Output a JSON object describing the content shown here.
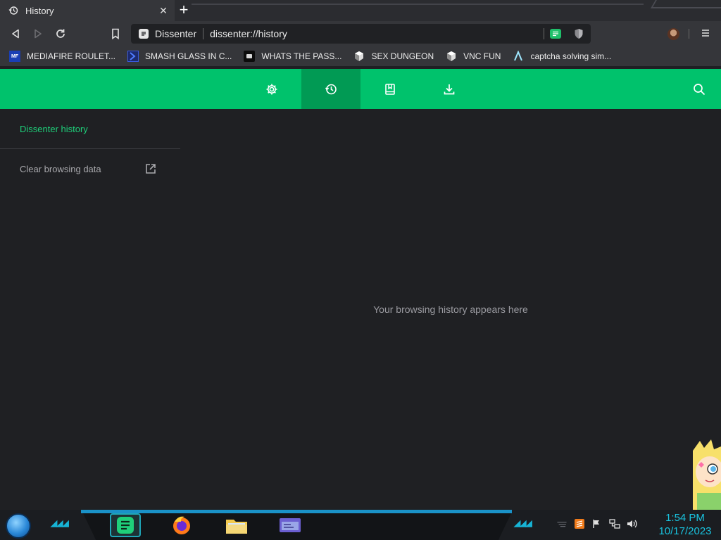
{
  "tab": {
    "title": "History",
    "close_glyph": "✕",
    "icon": "history-icon"
  },
  "newtab_glyph": "+",
  "toolbar": {
    "site_name": "Dissenter",
    "url": "dissenter://history"
  },
  "bookmarks": [
    {
      "label": "MEDIAFIRE ROULET...",
      "icon": "mediafire-icon",
      "badge": "MF"
    },
    {
      "label": "SMASH GLASS IN C...",
      "icon": "chevron-bookmark-icon",
      "badge": ""
    },
    {
      "label": "WHATS THE PASS...",
      "icon": "dark-bookmark-icon",
      "badge": ""
    },
    {
      "label": "SEX DUNGEON",
      "icon": "cube-bookmark-icon",
      "badge": ""
    },
    {
      "label": "VNC FUN",
      "icon": "cube-bookmark-icon",
      "badge": ""
    },
    {
      "label": "captcha solving sim...",
      "icon": "lambda-bookmark-icon",
      "badge": ""
    }
  ],
  "sidebar": {
    "title": "Dissenter history",
    "clear_label": "Clear browsing data"
  },
  "main": {
    "empty_message": "Your browsing history appears here"
  },
  "clock": {
    "time": "1:54 PM",
    "date": "10/17/2023"
  },
  "colors": {
    "accent": "#00c26c",
    "accent_active": "#019a54",
    "background": "#1f2023",
    "clock": "#19c4e0"
  }
}
